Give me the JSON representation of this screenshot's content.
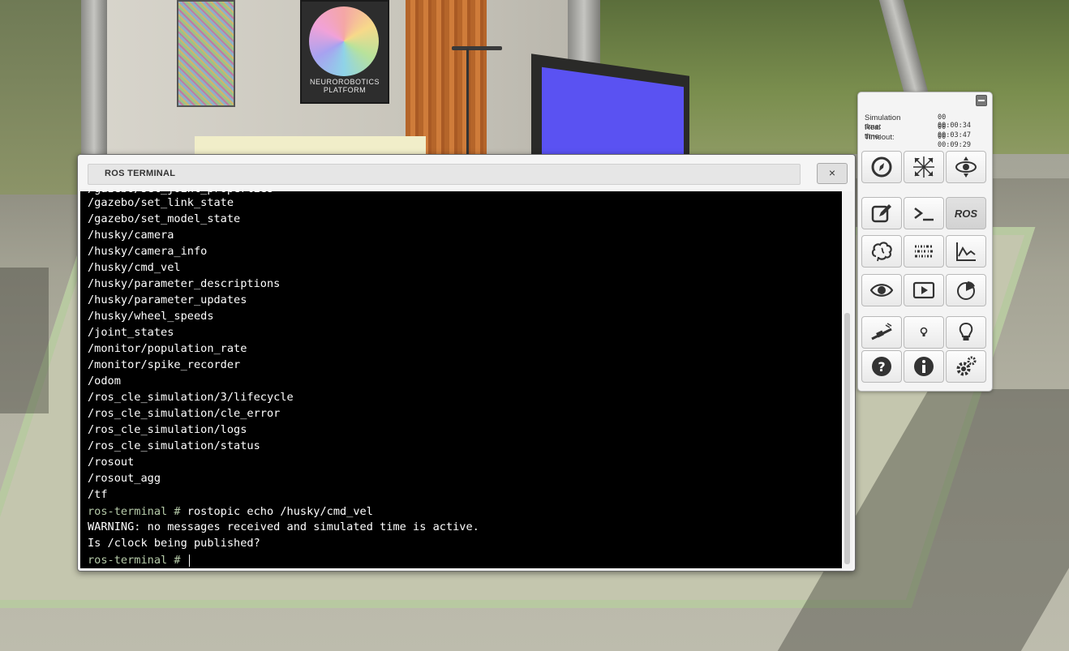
{
  "terminal": {
    "title": "ROS TERMINAL",
    "close_label": "×",
    "lines": [
      {
        "text": "/gazebo/set_link_state"
      },
      {
        "text": "/gazebo/set_model_state"
      },
      {
        "text": "/husky/camera"
      },
      {
        "text": "/husky/camera_info"
      },
      {
        "text": "/husky/cmd_vel"
      },
      {
        "text": "/husky/parameter_descriptions"
      },
      {
        "text": "/husky/parameter_updates"
      },
      {
        "text": "/husky/wheel_speeds"
      },
      {
        "text": "/joint_states"
      },
      {
        "text": "/monitor/population_rate"
      },
      {
        "text": "/monitor/spike_recorder"
      },
      {
        "text": "/odom"
      },
      {
        "text": "/ros_cle_simulation/3/lifecycle"
      },
      {
        "text": "/ros_cle_simulation/cle_error"
      },
      {
        "text": "/ros_cle_simulation/logs"
      },
      {
        "text": "/ros_cle_simulation/status"
      },
      {
        "text": "/rosout"
      },
      {
        "text": "/rosout_agg"
      },
      {
        "text": "/tf"
      }
    ],
    "command_prompt": "ros-terminal # ",
    "command": "rostopic echo /husky/cmd_vel",
    "output_1": "WARNING: no messages received and simulated time is active.",
    "output_2": "Is /clock being published?",
    "current_prompt": "ros-terminal # "
  },
  "scene": {
    "logo_text": "NEUROROBOTICS PLATFORM"
  },
  "sim_panel": {
    "times": [
      {
        "label": "Simulation time:",
        "value": "00 00:00:34"
      },
      {
        "label": "Real time:",
        "value": "00 00:03:47"
      },
      {
        "label": "Timeout:",
        "value": "00 00:09:29"
      }
    ],
    "ros_label": "ROS",
    "icons": [
      "compass-icon",
      "move-arrows-icon",
      "orbit-icon",
      "edit-icon",
      "terminal-icon",
      "ros-button",
      "brain-icon",
      "spike-raster-icon",
      "line-chart-icon",
      "eye-icon",
      "play-video-icon",
      "pie-chart-icon",
      "light-slider-icon",
      "small-bulb-icon",
      "big-bulb-icon",
      "help-icon",
      "info-icon",
      "settings-icon"
    ]
  }
}
